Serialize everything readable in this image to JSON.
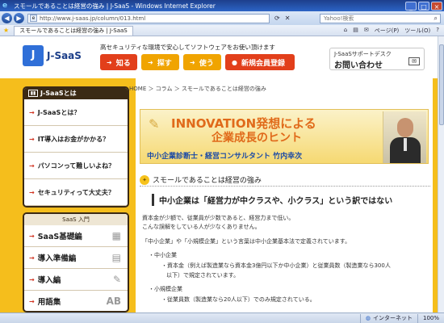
{
  "window": {
    "title": "スモールであることは経営の強み | J-SaaS - Windows Internet Explorer",
    "btn_min": "_",
    "btn_max": "□",
    "btn_close": "×"
  },
  "address": {
    "url": "http://www.j-saas.jp/column/013.html",
    "search_placeholder": "Yahoo!検索"
  },
  "tabbar": {
    "tab_label": "スモールであることは経営の強み | J-SaaS",
    "tools": [
      "⌂",
      "▤",
      "✉",
      "ページ(P)",
      "ツール(O)",
      "?"
    ]
  },
  "header": {
    "logo_mark": "J",
    "logo_text": "J-SaaS",
    "tagline": "高セキュリティな環境で安心してソフトウェアをお使い頂けます",
    "nav": [
      {
        "label": "知る"
      },
      {
        "label": "探す"
      },
      {
        "label": "使う"
      },
      {
        "label": "新規会員登録"
      }
    ],
    "support_top": "J-SaaSサポートデスク",
    "support_bottom": "お問い合わせ"
  },
  "sidebar": {
    "about_title": "J-SaaSとは",
    "about_items": [
      {
        "label": "J-SaaSとは？"
      },
      {
        "label": "IT導入はお金がかかる？"
      },
      {
        "label": "パソコンって難しいよね？"
      },
      {
        "label": "セキュリティって大丈夫？"
      }
    ],
    "intro_title": "SaaS 入門",
    "intro_items": [
      {
        "label": "SaaS基礎編"
      },
      {
        "label": "導入準備編"
      },
      {
        "label": "導入編"
      },
      {
        "label": "用語集"
      }
    ]
  },
  "content": {
    "breadcrumb": "HOME ＞ コラム ＞ スモールであることは経営の強み",
    "banner_line1": "INNOVATION発想による",
    "banner_line2": "企業成長のヒント",
    "banner_author": "中小企業診断士・経営コンサルタント 竹内幸次",
    "section_title": "スモールであることは経営の強み",
    "heading": "中小企業は「経営力が中クラスや、小クラス」という訳ではない",
    "p1": "資本金が少額で、従業員が少数であると、経営力まで低い。",
    "p2": "こんな誤解をしている人が少なくありません。",
    "p3": "「中小企業」や「小規模企業」という言葉は中小企業基本法で定義されています。",
    "li1": "・中小企業",
    "li1a": "・資本金（例えば製造業なら資本金3億円以下か中小企業）と従業員数（製造業なら300人",
    "li1b": "以下）で規定されています。",
    "li2": "・小規模企業",
    "li2a": "・従業員数（製造業なら20人以下）でのみ規定されている。"
  },
  "status": {
    "zone": "インターネット",
    "zoom": "100%"
  }
}
